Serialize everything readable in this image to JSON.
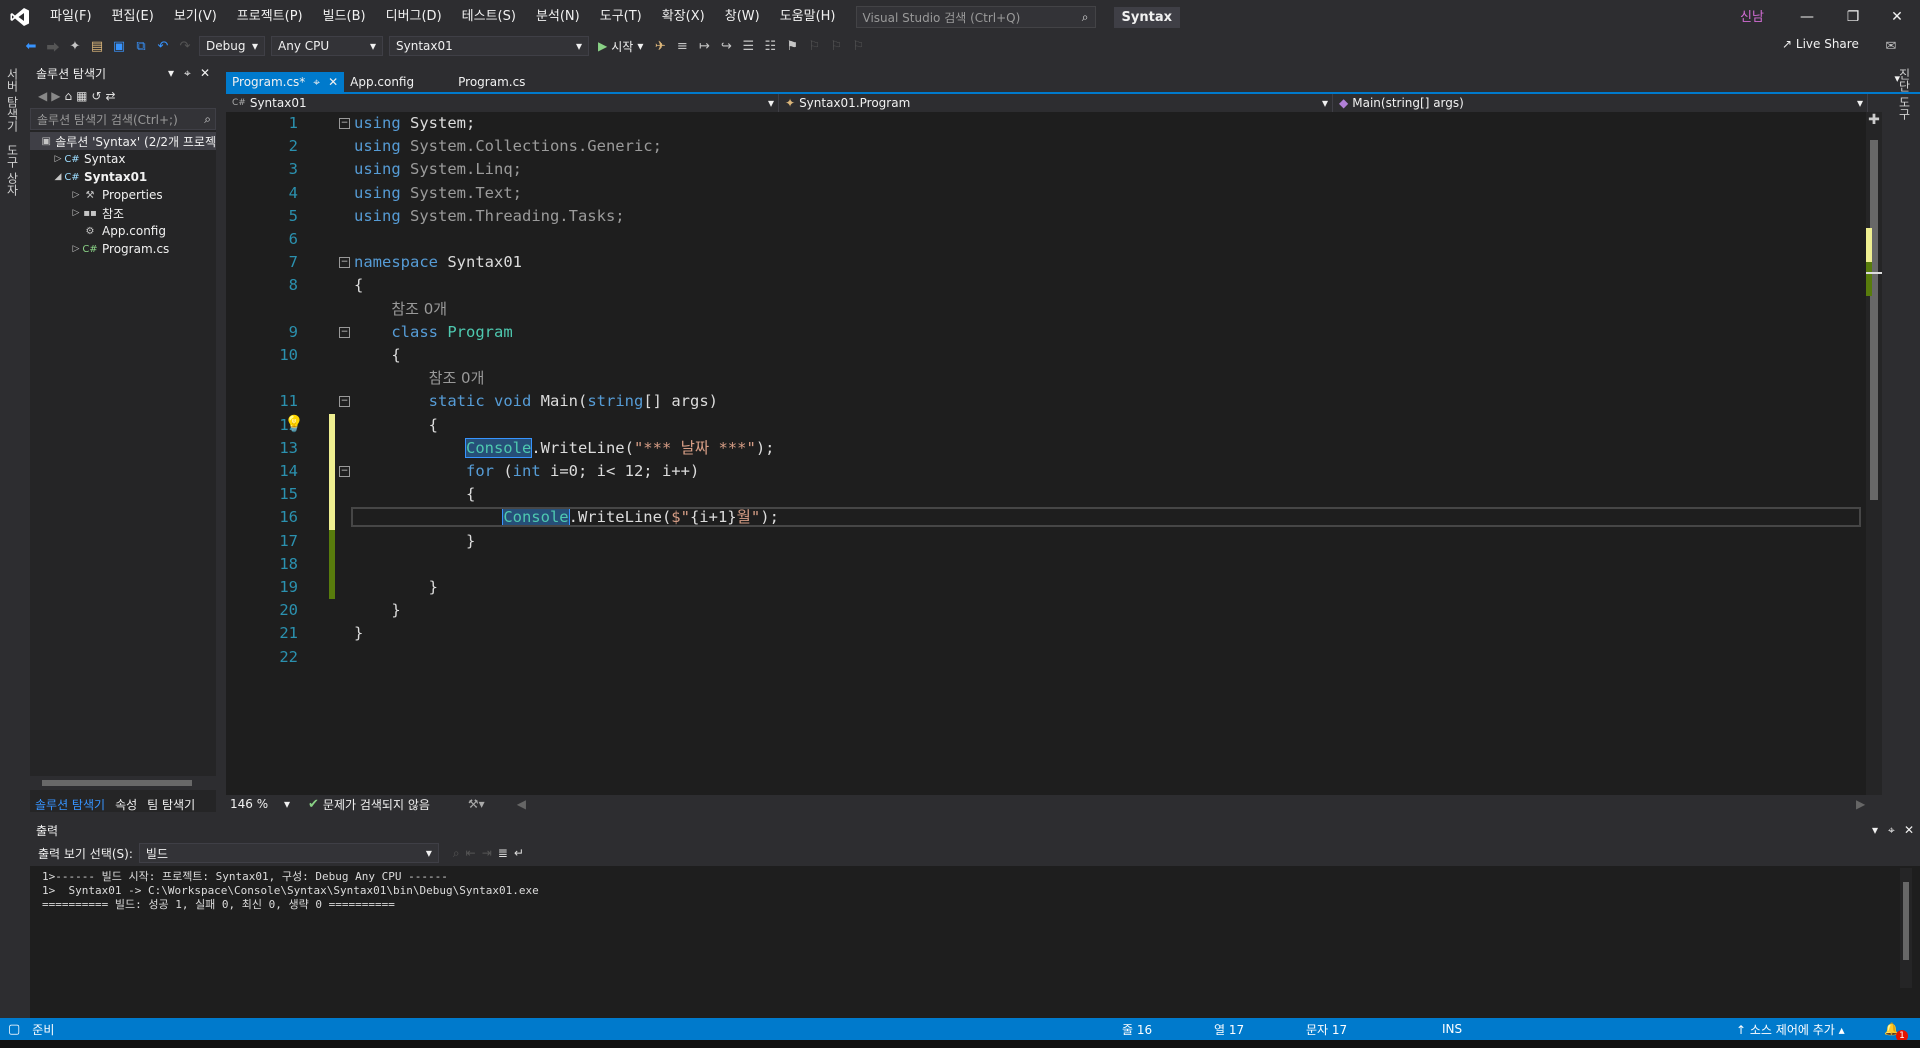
{
  "menubar": {
    "items": [
      "파일(F)",
      "편집(E)",
      "보기(V)",
      "프로젝트(P)",
      "빌드(B)",
      "디버그(D)",
      "테스트(S)",
      "분석(N)",
      "도구(T)",
      "확장(X)",
      "창(W)",
      "도움말(H)"
    ],
    "search_placeholder": "Visual Studio 검색 (Ctrl+Q)",
    "solution_title": "Syntax",
    "user": "신남"
  },
  "toolbar": {
    "config": "Debug",
    "platform": "Any CPU",
    "startup_project": "Syntax01",
    "start_label": "시작",
    "live_share": "Live Share"
  },
  "left_strip": {
    "tabs": [
      "서버 탐색기",
      "도구 상자"
    ]
  },
  "right_strip": {
    "tabs": [
      "진단 도구"
    ]
  },
  "solution_explorer": {
    "title": "솔루션 탐색기",
    "search_placeholder": "솔루션 탐색기 검색(Ctrl+;)",
    "tree": [
      {
        "label": "솔루션 'Syntax' (2/2개 프로젝",
        "indent": 0,
        "arrow": "",
        "icon": "sln"
      },
      {
        "label": "Syntax",
        "indent": 1,
        "arrow": "▷",
        "icon": "C#"
      },
      {
        "label": "Syntax01",
        "indent": 1,
        "arrow": "◢",
        "icon": "C#",
        "bold": true
      },
      {
        "label": "Properties",
        "indent": 2,
        "arrow": "▷",
        "icon": "wrench"
      },
      {
        "label": "참조",
        "indent": 2,
        "arrow": "▷",
        "icon": "ref"
      },
      {
        "label": "App.config",
        "indent": 2,
        "arrow": "",
        "icon": "cfg"
      },
      {
        "label": "Program.cs",
        "indent": 2,
        "arrow": "▷",
        "icon": "c#"
      }
    ],
    "bottom_tabs": [
      "솔루션 탐색기",
      "속성",
      "팀 탐색기"
    ]
  },
  "doc_tabs": [
    {
      "label": "Program.cs*",
      "active": true
    },
    {
      "label": "App.config",
      "active": false
    },
    {
      "label": "Program.cs",
      "active": false
    }
  ],
  "navbar": {
    "project": "Syntax01",
    "type": "Syntax01.Program",
    "member": "Main(string[] args)"
  },
  "code_lines": [
    {
      "n": "1",
      "html": "<span class='kw'>using</span> System;"
    },
    {
      "n": "2",
      "html": "<span class='dim'><span class='kw'>using</span> System.Collections.Generic;</span>"
    },
    {
      "n": "3",
      "html": "<span class='dim'><span class='kw'>using</span> System.Linq;</span>"
    },
    {
      "n": "4",
      "html": "<span class='dim'><span class='kw'>using</span> System.Text;</span>"
    },
    {
      "n": "5",
      "html": "<span class='dim'><span class='kw'>using</span> System.Threading.Tasks;</span>"
    },
    {
      "n": "6",
      "html": ""
    },
    {
      "n": "7",
      "html": "<span class='kw'>namespace</span> Syntax01"
    },
    {
      "n": "8",
      "html": "{"
    },
    {
      "n": "",
      "html": "    <span class='lens'>참조 0개</span>"
    },
    {
      "n": "9",
      "html": "    <span class='kw'>class</span> <span class='ty'>Program</span>"
    },
    {
      "n": "10",
      "html": "    {"
    },
    {
      "n": "",
      "html": "        <span class='lens'>참조 0개</span>"
    },
    {
      "n": "11",
      "html": "        <span class='kw'>static</span> <span class='kw'>void</span> Main(<span class='kw'>string</span>[] args)"
    },
    {
      "n": "12",
      "html": "        {"
    },
    {
      "n": "13",
      "html": "            <span class='ty hl'>Console</span>.WriteLine(<span class='str'>\"*** 날짜 ***\"</span>);"
    },
    {
      "n": "14",
      "html": "            <span class='kw'>for</span> (<span class='kw'>int</span> i=0; i&lt; 12; i++)"
    },
    {
      "n": "15",
      "html": "            {"
    },
    {
      "n": "16",
      "html": "                <span class='ty hl'>Console</span>.WriteLine(<span class='str'>$\"</span>{i+1}<span class='str'>월\"</span>);"
    },
    {
      "n": "17",
      "html": "            }"
    },
    {
      "n": "18",
      "html": ""
    },
    {
      "n": "19",
      "html": "        }"
    },
    {
      "n": "20",
      "html": "    }"
    },
    {
      "n": "21",
      "html": "}"
    },
    {
      "n": "22",
      "html": ""
    }
  ],
  "editor_status": {
    "zoom": "146 %",
    "issues": "문제가 검색되지 않음"
  },
  "output": {
    "title": "출력",
    "source_label": "출력 보기 선택(S):",
    "source_value": "빌드",
    "lines": [
      "1>------ 빌드 시작: 프로젝트: Syntax01, 구성: Debug Any CPU ------",
      "1>  Syntax01 -> C:\\Workspace\\Console\\Syntax\\Syntax01\\bin\\Debug\\Syntax01.exe",
      "========== 빌드: 성공 1, 실패 0, 최신 0, 생략 0 =========="
    ]
  },
  "statusbar": {
    "ready": "준비",
    "line": "줄 16",
    "col": "열 17",
    "char": "문자 17",
    "ins": "INS",
    "source_control": "소스 제어에 추가",
    "notifications": "1"
  }
}
